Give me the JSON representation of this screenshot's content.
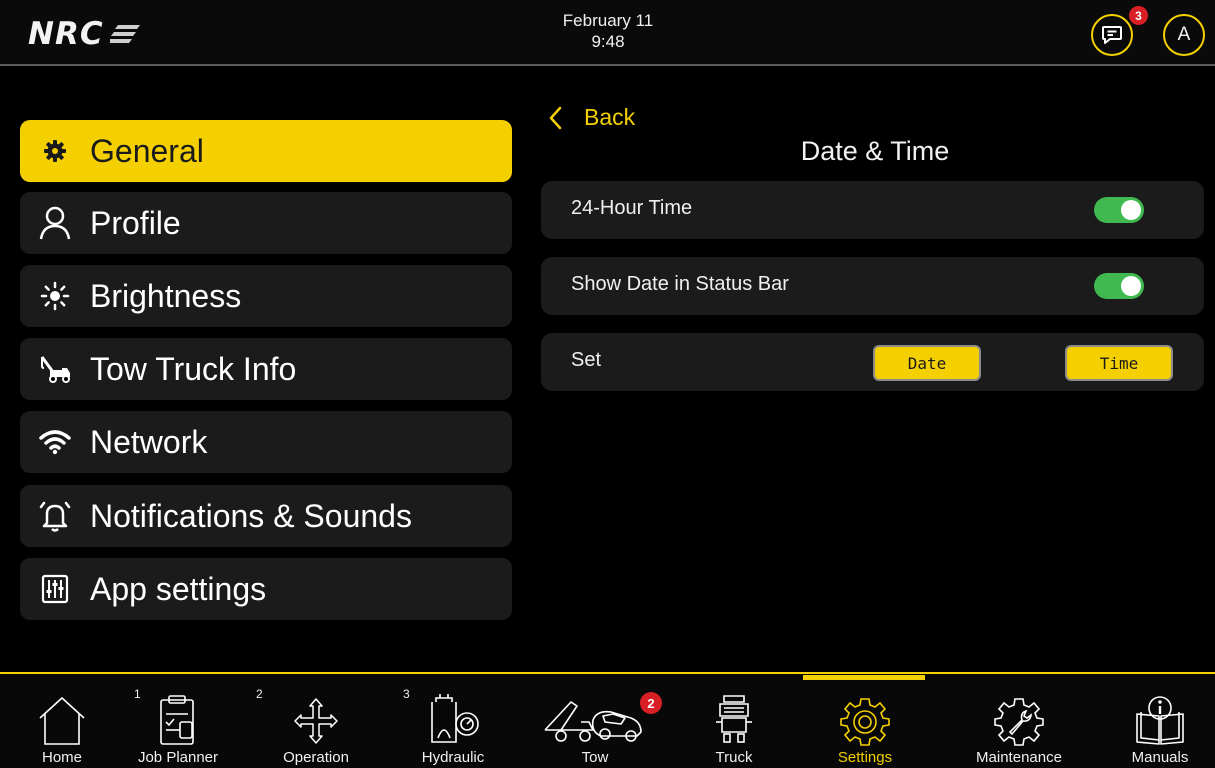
{
  "statusbar": {
    "logo_text": "NRC",
    "date": "February 11",
    "time": "9:48",
    "messages_badge": "3",
    "avatar_initial": "A"
  },
  "sidebar": {
    "items": [
      {
        "label": "General",
        "icon": "gear-icon",
        "active": true
      },
      {
        "label": "Profile",
        "icon": "person-icon",
        "active": false
      },
      {
        "label": "Brightness",
        "icon": "sun-icon",
        "active": false
      },
      {
        "label": "Tow Truck Info",
        "icon": "tow-truck-icon",
        "active": false
      },
      {
        "label": "Network",
        "icon": "wifi-icon",
        "active": false
      },
      {
        "label": "Notifications & Sounds",
        "icon": "bell-icon",
        "active": false
      },
      {
        "label": "App settings",
        "icon": "sliders-icon",
        "active": false
      }
    ]
  },
  "main": {
    "back_label": "Back",
    "title": "Date & Time",
    "rows": {
      "hour24": {
        "label": "24-Hour Time",
        "enabled": true
      },
      "show_date": {
        "label": "Show Date in Status Bar",
        "enabled": true
      },
      "set": {
        "label": "Set",
        "date_button": "Date",
        "time_button": "Time"
      }
    }
  },
  "bottom_nav": {
    "items": [
      {
        "label": "Home",
        "icon": "home-icon"
      },
      {
        "label": "Job Planner",
        "icon": "clipboard-icon",
        "number": "1"
      },
      {
        "label": "Operation",
        "icon": "move-arrows-icon",
        "number": "2"
      },
      {
        "label": "Hydraulic",
        "icon": "hydraulic-icon",
        "number": "3"
      },
      {
        "label": "Tow",
        "icon": "tow-icon",
        "badge": "2"
      },
      {
        "label": "Truck",
        "icon": "truck-icon"
      },
      {
        "label": "Settings",
        "icon": "settings-gear-icon",
        "active": true
      },
      {
        "label": "Maintenance",
        "icon": "wrench-gear-icon"
      },
      {
        "label": "Manuals",
        "icon": "manual-icon"
      }
    ]
  },
  "colors": {
    "accent": "#f5d000",
    "toggle_on": "#3fb950",
    "badge": "#d81f26",
    "panel": "#1b1b1b",
    "background": "#000000"
  }
}
